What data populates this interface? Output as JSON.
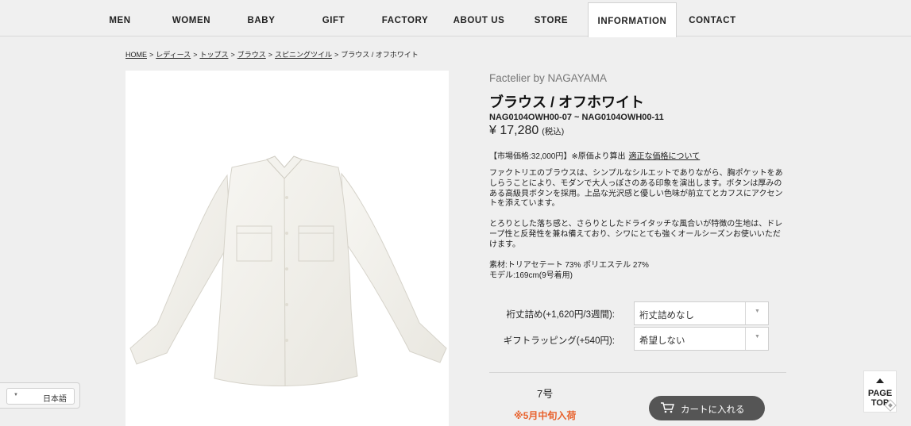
{
  "nav": {
    "items": [
      {
        "label": "MEN"
      },
      {
        "label": "WOMEN"
      },
      {
        "label": "BABY"
      },
      {
        "label": "GIFT"
      },
      {
        "label": "FACTORY"
      },
      {
        "label": "ABOUT US"
      },
      {
        "label": "STORE"
      },
      {
        "label": "INFORMATION",
        "active": true
      },
      {
        "label": "CONTACT"
      }
    ]
  },
  "breadcrumb": {
    "items": [
      "HOME",
      "レディース",
      "トップス",
      "ブラウス",
      "スピニングツイル"
    ],
    "current": "ブラウス / オフホワイト",
    "separator": ">"
  },
  "product": {
    "brand": "Factelier by NAGAYAMA",
    "title": "ブラウス / オフホワイト",
    "sku": "NAG0104OWH00-07 ~ NAG0104OWH00-11",
    "price": "¥ 17,280",
    "tax_note": "(税込)",
    "market_price": "【市場価格:32,000円】※原価より算出",
    "market_link": "適正な価格について",
    "description_1": "ファクトリエのブラウスは、シンプルなシルエットでありながら、胸ポケットをあしらうことにより、モダンで大人っぽさのある印象を演出します。ボタンは厚みのある高級貝ボタンを採用。上品な光沢感と優しい色味が前立てとカフスにアクセントを添えています。",
    "description_2": "とろりとした落ち感と、さらりとしたドライタッチな風合いが特徴の生地は、ドレープ性と反発性を兼ね備えており、シワにとても強くオールシーズンお使いいただけます。",
    "material": "素材:トリアセテート 73% ポリエステル 27%",
    "model": "モデル:169cm(9号着用)"
  },
  "options": {
    "hem_label": "裄丈詰め(+1,620円/3週間):",
    "hem_value": "裄丈詰めなし",
    "gift_label": "ギフトラッピング(+540円):",
    "gift_value": "希望しない"
  },
  "purchase": {
    "size": "7号",
    "restock": "※5月中旬入荷",
    "cart_label": "カートに入れる"
  },
  "language": {
    "selected": "日本語"
  },
  "page_top": {
    "line1": "PAGE",
    "line2": "TOP"
  },
  "colors": {
    "accent_orange": "#e8622d",
    "cart_button": "#555555",
    "background": "#efefef"
  }
}
